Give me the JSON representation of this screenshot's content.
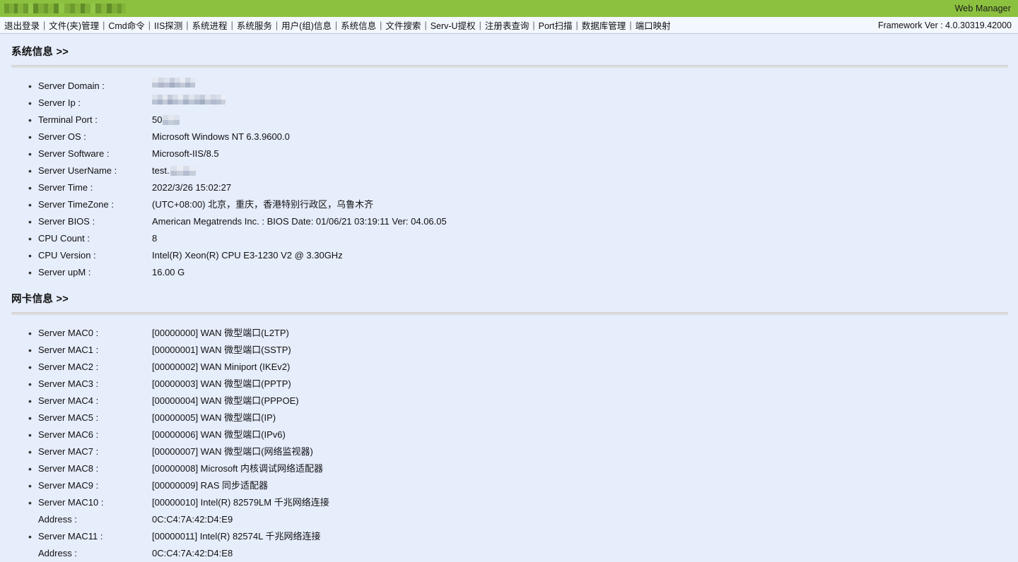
{
  "topbar": {
    "site_title_redacted": true,
    "right_label": "Web Manager",
    "green": "#8cc03f"
  },
  "nav": {
    "items": [
      "退出登录",
      "文件(夹)管理",
      "Cmd命令",
      "IIS探测",
      "系统进程",
      "系统服务",
      "用户(组)信息",
      "系统信息",
      "文件搜索",
      "Serv-U提权",
      "注册表查询",
      "Port扫描",
      "数据库管理",
      "端口映射"
    ],
    "separator": "|",
    "framework_label": "Framework Ver : 4.0.30319.42000"
  },
  "sections": [
    {
      "heading": "系统信息 >>",
      "rows": [
        {
          "label": "Server Domain :",
          "value": "",
          "redact": "domain"
        },
        {
          "label": "Server Ip :",
          "value": "",
          "redact": "ip"
        },
        {
          "label": "Terminal Port :",
          "value": "50",
          "redact": "port"
        },
        {
          "label": "Server OS :",
          "value": "Microsoft Windows NT 6.3.9600.0"
        },
        {
          "label": "Server Software :",
          "value": "Microsoft-IIS/8.5"
        },
        {
          "label": "Server UserName :",
          "value": "test.",
          "redact": "user"
        },
        {
          "label": "Server Time :",
          "value": "2022/3/26 15:02:27"
        },
        {
          "label": "Server TimeZone :",
          "value": "(UTC+08:00) 北京，重庆，香港特别行政区，乌鲁木齐"
        },
        {
          "label": "Server BIOS :",
          "value": "American Megatrends Inc. : BIOS Date: 01/06/21 03:19:11 Ver: 04.06.05"
        },
        {
          "label": "CPU Count :",
          "value": "8"
        },
        {
          "label": "CPU Version :",
          "value": "Intel(R) Xeon(R) CPU E3-1230 V2 @ 3.30GHz"
        },
        {
          "label": "Server upM :",
          "value": "16.00 G"
        }
      ]
    },
    {
      "heading": "网卡信息 >>",
      "rows": [
        {
          "label": "Server MAC0 :",
          "value": "[00000000] WAN 微型端口(L2TP)"
        },
        {
          "label": "Server MAC1 :",
          "value": "[00000001] WAN 微型端口(SSTP)"
        },
        {
          "label": "Server MAC2 :",
          "value": "[00000002] WAN Miniport (IKEv2)"
        },
        {
          "label": "Server MAC3 :",
          "value": "[00000003] WAN 微型端口(PPTP)"
        },
        {
          "label": "Server MAC4 :",
          "value": "[00000004] WAN 微型端口(PPPOE)"
        },
        {
          "label": "Server MAC5 :",
          "value": "[00000005] WAN 微型端口(IP)"
        },
        {
          "label": "Server MAC6 :",
          "value": "[00000006] WAN 微型端口(IPv6)"
        },
        {
          "label": "Server MAC7 :",
          "value": "[00000007] WAN 微型端口(网络监视器)"
        },
        {
          "label": "Server MAC8 :",
          "value": "[00000008] Microsoft 内核调试网络适配器"
        },
        {
          "label": "Server MAC9 :",
          "value": "[00000009] RAS 同步适配器"
        },
        {
          "label": "Server MAC10 :",
          "value": "[00000010] Intel(R) 82579LM 千兆网络连接"
        },
        {
          "label": "Address :",
          "value": "0C:C4:7A:42:D4:E9",
          "no_bullet": true
        },
        {
          "label": "Server MAC11 :",
          "value": "[00000011] Intel(R) 82574L 千兆网络连接"
        },
        {
          "label": "Address :",
          "value": "0C:C4:7A:42:D4:E8",
          "no_bullet": true
        }
      ]
    }
  ]
}
